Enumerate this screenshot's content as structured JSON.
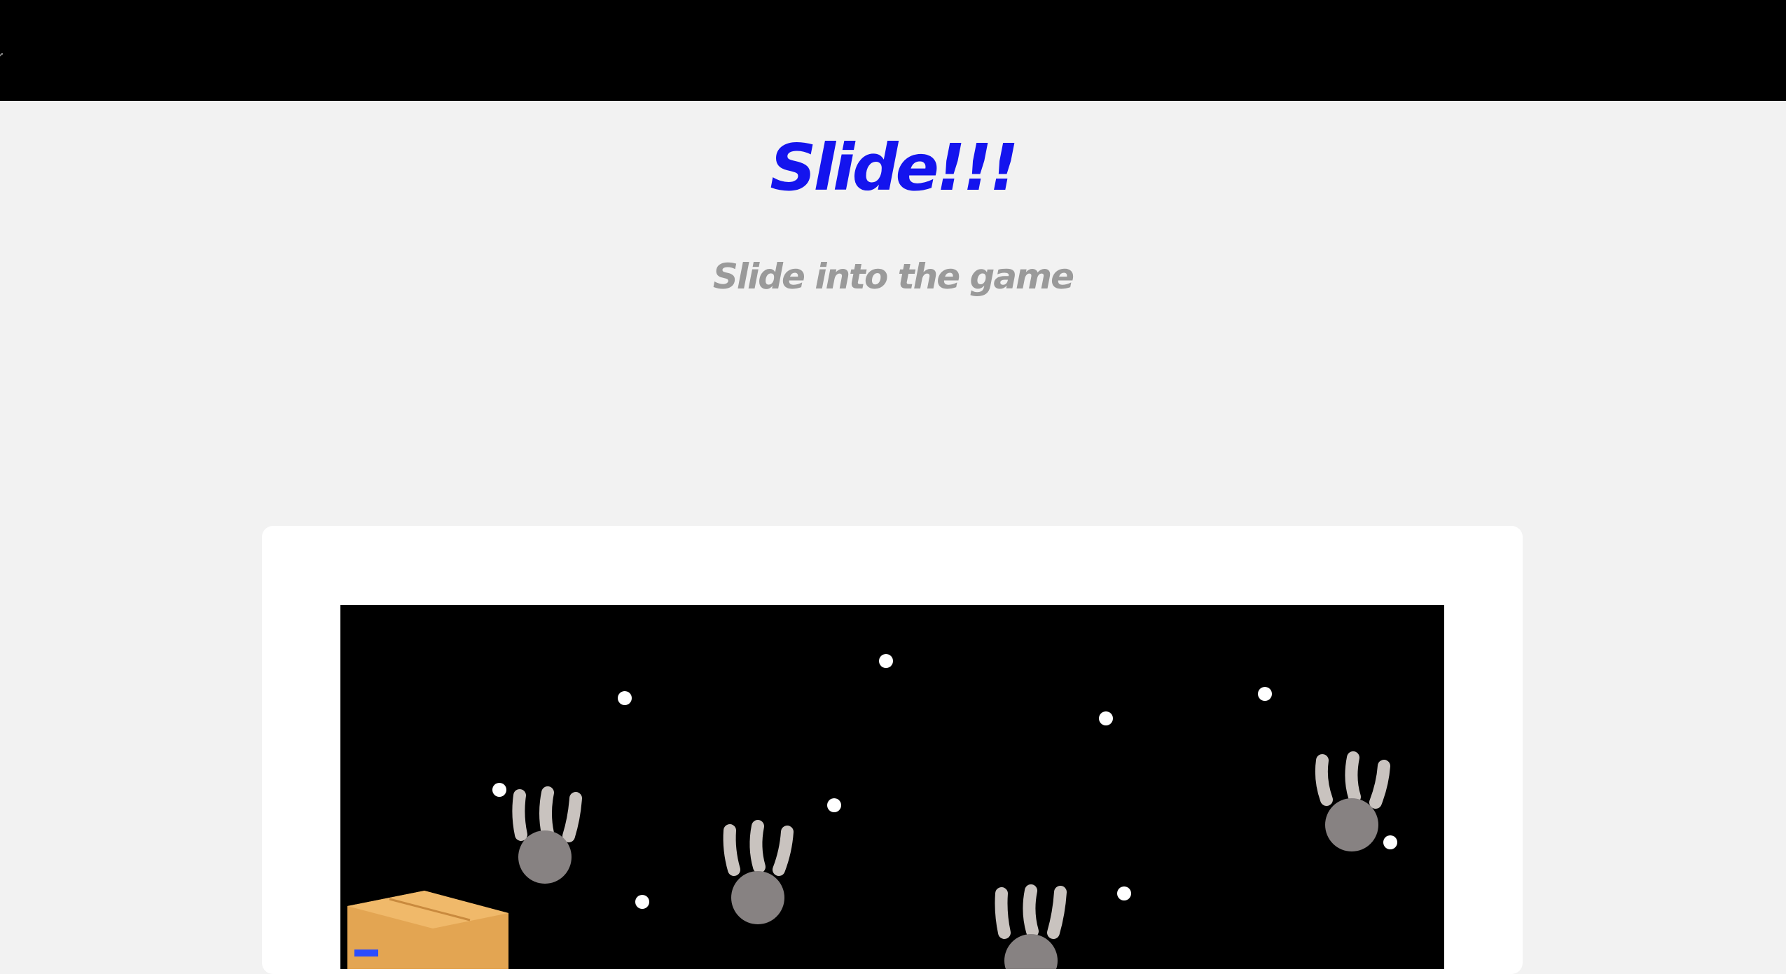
{
  "header": {
    "edge_glyph": "^"
  },
  "hero": {
    "title": "Slide!!!",
    "subtitle": "Slide into the game"
  },
  "colors": {
    "title": "#1414ee",
    "subtitle": "#9a9a9a",
    "topbar": "#000000",
    "page_background": "#f2f2f2",
    "card": "#ffffff",
    "game_background": "#000000",
    "star": "#ffffff",
    "creature_body": "#878282",
    "creature_fingers": "#c9c3bf",
    "box": "#e7a857"
  },
  "game": {
    "sprites": [
      "star",
      "creature",
      "player-box"
    ]
  }
}
